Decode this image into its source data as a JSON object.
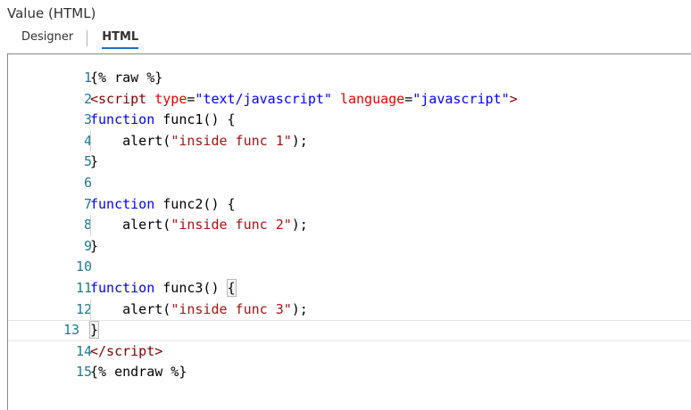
{
  "field": {
    "label": "Value (HTML)"
  },
  "tabs": [
    {
      "label": "Designer",
      "active": false
    },
    {
      "label": "HTML",
      "active": true
    }
  ],
  "colors": {
    "line_number": "#237893",
    "keyword": "#0000ff",
    "tag": "#800000",
    "attribute": "#e50000",
    "attr_value": "#0000ff",
    "string": "#a31515",
    "active_tab_underline": "#1f6fc3"
  },
  "editor": {
    "current_line": 13,
    "lines": [
      {
        "n": "1",
        "tokens": [
          {
            "t": "{% raw %}",
            "c": "text"
          }
        ]
      },
      {
        "n": "2",
        "tokens": [
          {
            "t": "<script",
            "c": "tag"
          },
          {
            "t": " ",
            "c": "text"
          },
          {
            "t": "type",
            "c": "attr"
          },
          {
            "t": "=",
            "c": "text"
          },
          {
            "t": "\"text/javascript\"",
            "c": "str"
          },
          {
            "t": " ",
            "c": "text"
          },
          {
            "t": "language",
            "c": "attr"
          },
          {
            "t": "=",
            "c": "text"
          },
          {
            "t": "\"javascript\"",
            "c": "str"
          },
          {
            "t": ">",
            "c": "tag"
          }
        ]
      },
      {
        "n": "3",
        "tokens": [
          {
            "t": "function",
            "c": "kw"
          },
          {
            "t": " func1() {",
            "c": "text"
          }
        ]
      },
      {
        "n": "4",
        "indent": true,
        "tokens": [
          {
            "t": "    alert(",
            "c": "text"
          },
          {
            "t": "\"inside func 1\"",
            "c": "strjs"
          },
          {
            "t": ");",
            "c": "text"
          }
        ]
      },
      {
        "n": "5",
        "tokens": [
          {
            "t": "}",
            "c": "text"
          }
        ]
      },
      {
        "n": "6",
        "tokens": []
      },
      {
        "n": "7",
        "tokens": [
          {
            "t": "function",
            "c": "kw"
          },
          {
            "t": " func2() {",
            "c": "text"
          }
        ]
      },
      {
        "n": "8",
        "indent": true,
        "tokens": [
          {
            "t": "    alert(",
            "c": "text"
          },
          {
            "t": "\"inside func 2\"",
            "c": "strjs"
          },
          {
            "t": ");",
            "c": "text"
          }
        ]
      },
      {
        "n": "9",
        "tokens": [
          {
            "t": "}",
            "c": "text"
          }
        ]
      },
      {
        "n": "10",
        "tokens": []
      },
      {
        "n": "11",
        "tokens": [
          {
            "t": "function",
            "c": "kw"
          },
          {
            "t": " func3() ",
            "c": "text"
          },
          {
            "t": "{",
            "c": "text",
            "match": true
          }
        ]
      },
      {
        "n": "12",
        "indent": true,
        "tokens": [
          {
            "t": "    alert(",
            "c": "text"
          },
          {
            "t": "\"inside func 3\"",
            "c": "strjs"
          },
          {
            "t": ");",
            "c": "text"
          }
        ]
      },
      {
        "n": "13",
        "tokens": [
          {
            "t": "}",
            "c": "text",
            "match": true
          }
        ]
      },
      {
        "n": "14",
        "tokens": [
          {
            "t": "</script",
            "c": "tag"
          },
          {
            "t": ">",
            "c": "tag"
          }
        ]
      },
      {
        "n": "15",
        "tokens": [
          {
            "t": "{% endraw %}",
            "c": "text"
          }
        ]
      }
    ]
  }
}
